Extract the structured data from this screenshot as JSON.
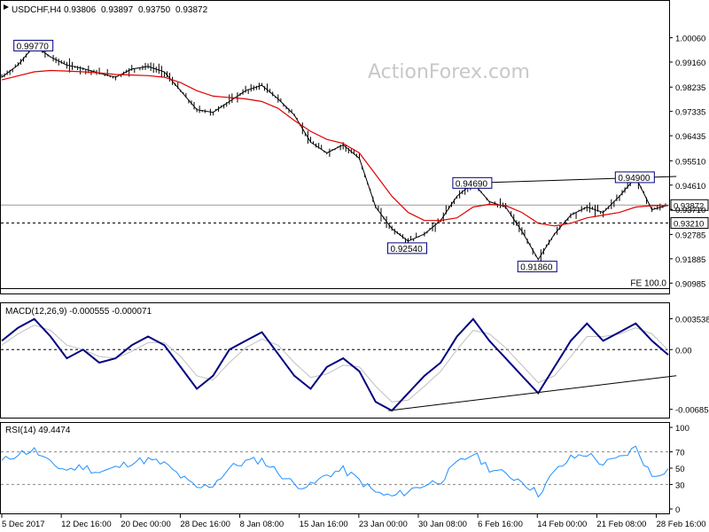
{
  "header": {
    "symbol_info": "USDCHF,H4",
    "open": "0.93806",
    "high": "0.93897",
    "low": "0.93750",
    "close": "0.93872"
  },
  "watermark": "ActionForex.com",
  "colors": {
    "price_bars": "#000000",
    "moving_average": "#e00000",
    "macd_line": "#000080",
    "macd_signal": "#c0c0c0",
    "rsi_line": "#1e90ff",
    "trendline": "#000000"
  },
  "chart_data": [
    {
      "type": "line",
      "title": "USDCHF,H4",
      "ylim": [
        0.907,
        1.008
      ],
      "y_ticks": [
        "1.00060",
        "0.99160",
        "0.98235",
        "0.97335",
        "0.96435",
        "0.95510",
        "0.94610",
        "0.93710",
        "0.92785",
        "0.91885",
        "0.90985"
      ],
      "x_ticks": [
        "5 Dec 2017",
        "12 Dec 16:00",
        "20 Dec 00:00",
        "28 Dec 16:00",
        "8 Jan 08:00",
        "15 Jan 16:00",
        "23 Jan 00:00",
        "30 Jan 08:00",
        "6 Feb 16:00",
        "14 Feb 00:00",
        "21 Feb 08:00",
        "28 Feb 16:00"
      ],
      "series": [
        {
          "name": "price",
          "y": [
            0.986,
            0.9905,
            0.9977,
            0.9935,
            0.9905,
            0.9892,
            0.9875,
            0.986,
            0.989,
            0.99,
            0.988,
            0.981,
            0.974,
            0.973,
            0.977,
            0.981,
            0.983,
            0.978,
            0.972,
            0.962,
            0.958,
            0.961,
            0.956,
            0.938,
            0.93,
            0.9254,
            0.928,
            0.933,
            0.942,
            0.9469,
            0.94,
            0.938,
            0.929,
            0.9186,
            0.928,
            0.935,
            0.938,
            0.936,
            0.942,
            0.949,
            0.937,
            0.9387
          ]
        },
        {
          "name": "moving average",
          "y": [
            0.985,
            0.9865,
            0.988,
            0.9885,
            0.9883,
            0.988,
            0.9876,
            0.987,
            0.9868,
            0.9866,
            0.986,
            0.984,
            0.981,
            0.979,
            0.9785,
            0.978,
            0.977,
            0.9745,
            0.97,
            0.966,
            0.963,
            0.9615,
            0.958,
            0.95,
            0.942,
            0.936,
            0.933,
            0.933,
            0.934,
            0.938,
            0.939,
            0.9385,
            0.936,
            0.932,
            0.931,
            0.932,
            0.934,
            0.935,
            0.936,
            0.938,
            0.9385,
            0.9385
          ]
        }
      ],
      "reference_lines": [
        {
          "label": "0.93872",
          "value": 0.93872,
          "style": "solid"
        },
        {
          "label": "0.93210",
          "value": 0.9321,
          "style": "dashed"
        },
        {
          "label": "FE 100.0",
          "value": 0.9078,
          "style": "solid"
        }
      ],
      "annotations": [
        {
          "label": "0.99770",
          "x_index": 2,
          "value": 0.9977
        },
        {
          "label": "0.94690",
          "x_index": 29,
          "value": 0.9469
        },
        {
          "label": "0.94900",
          "x_index": 39,
          "value": 0.949
        },
        {
          "label": "0.92540",
          "x_index": 25,
          "value": 0.9254
        },
        {
          "label": "0.91860",
          "x_index": 33,
          "value": 0.9186
        }
      ],
      "trendline": {
        "from": [
          29,
          0.9469
        ],
        "to": [
          41.5,
          0.9493
        ]
      }
    },
    {
      "type": "line",
      "title": "MACD(12,26,9) -0.000555 -0.000071",
      "ylim": [
        -0.0075,
        0.0045
      ],
      "y_ticks": [
        "0.003538",
        "0.00",
        "-0.006853"
      ],
      "series": [
        {
          "name": "macd",
          "y": [
            0.001,
            0.0025,
            0.0035,
            0.0015,
            -0.001,
            0.0,
            -0.0015,
            -0.001,
            0.0005,
            0.0015,
            0.0005,
            -0.002,
            -0.0045,
            -0.003,
            0.0,
            0.001,
            0.002,
            -0.0005,
            -0.003,
            -0.0045,
            -0.002,
            -0.001,
            -0.0025,
            -0.006,
            -0.007,
            -0.005,
            -0.003,
            -0.0015,
            0.0015,
            0.0035,
            0.001,
            -0.001,
            -0.003,
            -0.005,
            -0.002,
            0.001,
            0.003,
            0.001,
            0.002,
            0.003,
            0.001,
            -0.0006
          ]
        },
        {
          "name": "signal",
          "y": [
            0.0005,
            0.0018,
            0.0028,
            0.0022,
            0.0005,
            0.0,
            -0.0008,
            -0.001,
            -0.0002,
            0.0008,
            0.0008,
            -0.0008,
            -0.003,
            -0.0035,
            -0.0015,
            0.0002,
            0.0012,
            0.0005,
            -0.0015,
            -0.0032,
            -0.0028,
            -0.0018,
            -0.002,
            -0.0042,
            -0.006,
            -0.0058,
            -0.0042,
            -0.0025,
            0.0,
            0.0022,
            0.0018,
            0.0002,
            -0.0018,
            -0.0038,
            -0.003,
            -0.0008,
            0.0015,
            0.0015,
            0.0018,
            0.0025,
            0.0018,
            -0.0001
          ]
        }
      ],
      "trendline": {
        "from": [
          23.8,
          -0.007
        ],
        "to": [
          41.5,
          -0.003
        ]
      }
    },
    {
      "type": "line",
      "title": "RSI(14) 49.4474",
      "ylim": [
        0,
        100
      ],
      "y_ticks": [
        "100",
        "70",
        "50",
        "30",
        "0"
      ],
      "series": [
        {
          "name": "rsi",
          "y": [
            58,
            68,
            72,
            55,
            48,
            52,
            45,
            50,
            58,
            60,
            55,
            40,
            25,
            30,
            50,
            58,
            60,
            45,
            30,
            28,
            42,
            48,
            35,
            20,
            15,
            22,
            30,
            35,
            55,
            68,
            50,
            42,
            35,
            18,
            45,
            62,
            68,
            55,
            62,
            75,
            40,
            49.4474
          ]
        }
      ],
      "levels": [
        70,
        30
      ]
    }
  ]
}
